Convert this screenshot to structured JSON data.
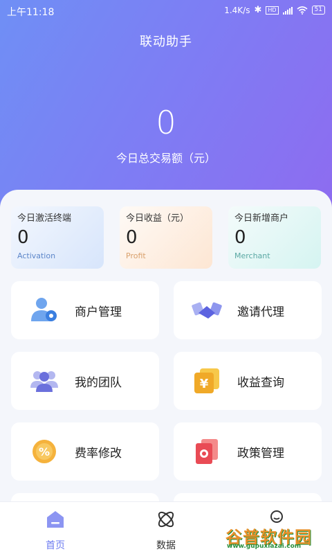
{
  "status_bar": {
    "time": "上午11:18",
    "speed": "1.4K/s",
    "battery": "51",
    "hd_badge": "HD"
  },
  "app": {
    "title": "联动助手"
  },
  "hero": {
    "value": "0",
    "label": "今日总交易额（元）"
  },
  "stats": [
    {
      "label": "今日激活终端",
      "value": "0",
      "en": "Activation"
    },
    {
      "label": "今日收益（元）",
      "value": "0",
      "en": "Profit"
    },
    {
      "label": "今日新增商户",
      "value": "0",
      "en": "Merchant"
    }
  ],
  "menu": [
    {
      "label": "商户管理",
      "icon": "merchant-icon"
    },
    {
      "label": "邀请代理",
      "icon": "handshake-icon"
    },
    {
      "label": "我的团队",
      "icon": "team-icon"
    },
    {
      "label": "收益查询",
      "icon": "yuan-icon"
    },
    {
      "label": "费率修改",
      "icon": "percent-icon"
    },
    {
      "label": "政策管理",
      "icon": "policy-icon"
    }
  ],
  "tabs": [
    {
      "label": "首页",
      "icon": "home-icon"
    },
    {
      "label": "数据",
      "icon": "atom-icon"
    },
    {
      "label": "",
      "icon": "user-icon"
    }
  ],
  "watermark": {
    "logo": "谷普软件园",
    "url": "www.gupuxiazai.com"
  },
  "colors": {
    "accent": "#6d7cf0",
    "hero_start": "#6f8ff5",
    "hero_end": "#8e6bf0"
  }
}
